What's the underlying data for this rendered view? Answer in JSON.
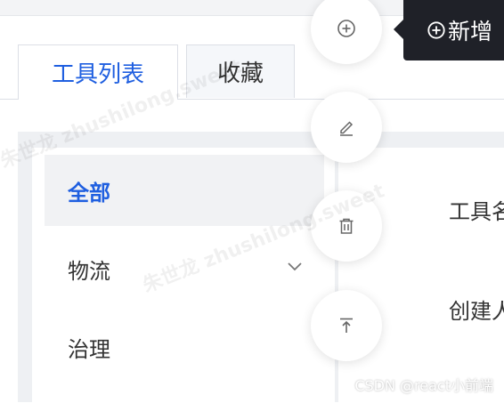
{
  "tabs": [
    {
      "label": "工具列表",
      "active": true
    },
    {
      "label": "收藏",
      "active": false
    }
  ],
  "sidebar": {
    "items": [
      {
        "label": "全部",
        "active": true
      },
      {
        "label": "物流",
        "expandable": true
      },
      {
        "label": "治理"
      }
    ]
  },
  "content": {
    "fields": [
      "工具名",
      "创建人"
    ]
  },
  "floating_actions": {
    "buttons": [
      "plus-circle-icon",
      "edit-icon",
      "delete-icon",
      "back-to-top-icon"
    ],
    "tooltip": "新增"
  },
  "watermark": {
    "text": "朱世龙 zhushilong.sweet"
  },
  "credit": "CSDN @react小前端",
  "colors": {
    "accent": "#1f5fe0",
    "tooltip_bg": "#1f2128",
    "panel_bg": "#eef0f3"
  }
}
